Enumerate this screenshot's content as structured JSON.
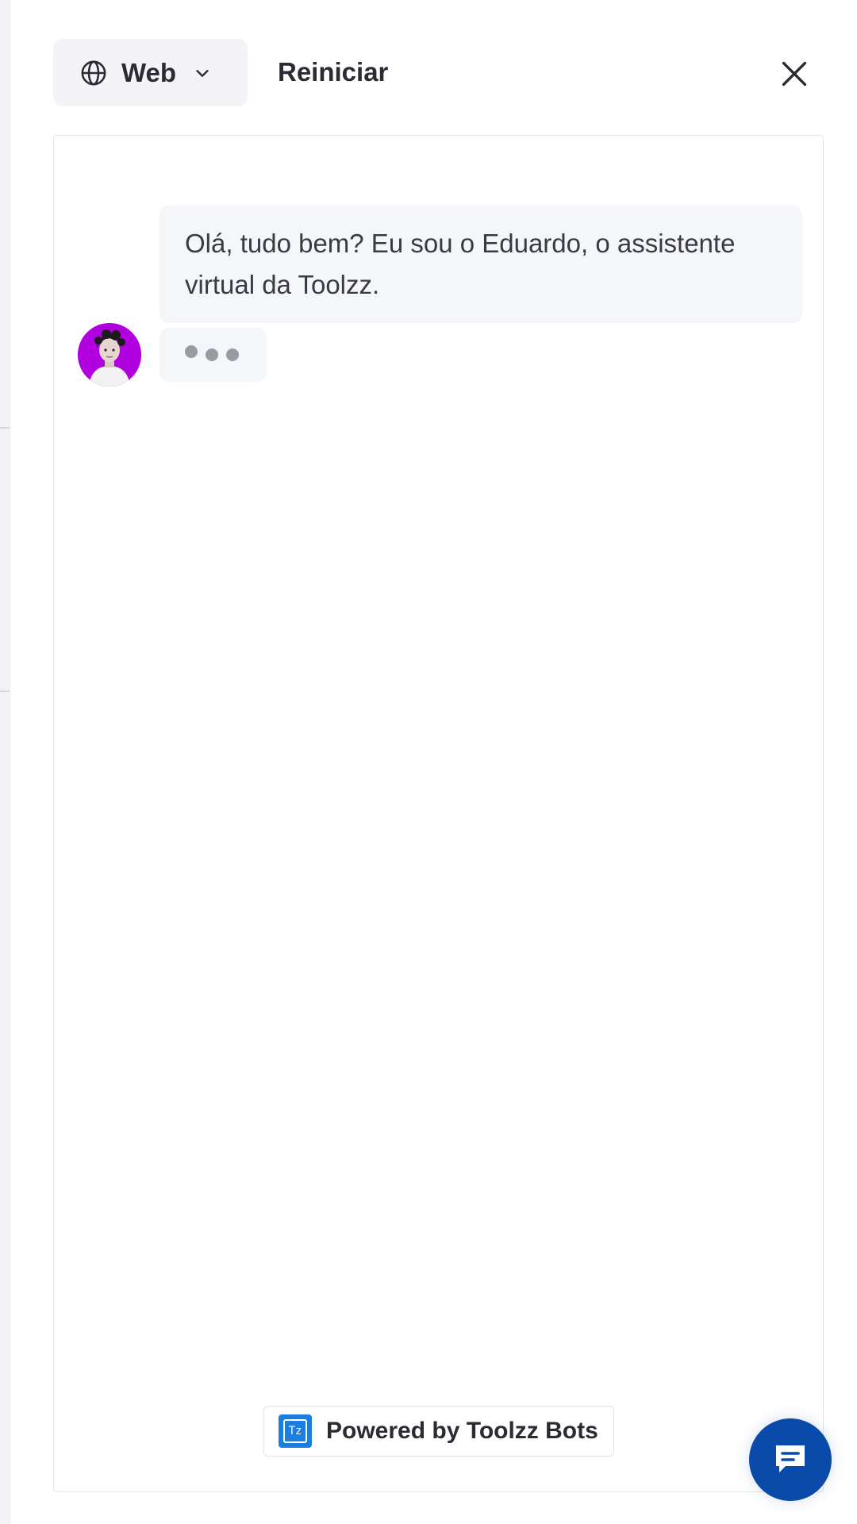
{
  "header": {
    "language_selector_label": "Web",
    "restart_label": "Reiniciar"
  },
  "chat": {
    "greeting_message": "Olá, tudo bem? Eu sou o Eduardo, o assistente virtual da Toolzz.",
    "typing_indicator": true
  },
  "footer": {
    "powered_by_label": "Powered by Toolzz Bots",
    "logo_text": "Tz"
  },
  "colors": {
    "launcher": "#0a4aa8",
    "avatar_background": "#b100e0",
    "logo": "#1a7fe0",
    "bubble_background": "#f5f6fa"
  },
  "icons": {
    "language": "globe-icon",
    "dropdown": "chevron-down-icon",
    "close": "close-icon",
    "launcher": "chat-bubble-icon"
  }
}
